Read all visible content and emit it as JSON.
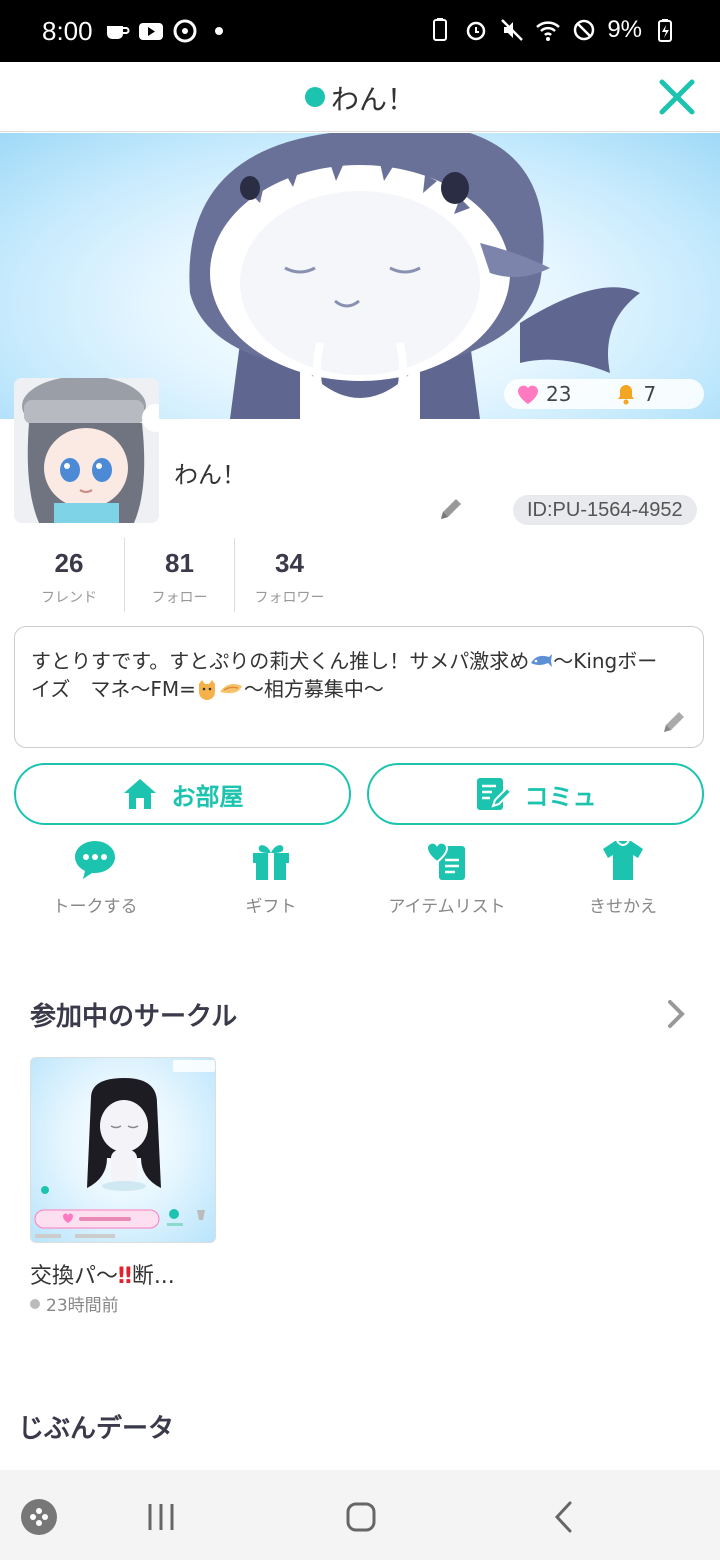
{
  "status_bar": {
    "time": "8:00",
    "battery": "9%"
  },
  "header": {
    "title": "わん！"
  },
  "banner": {
    "likes": "23",
    "bells": "7"
  },
  "profile": {
    "name": "わん！",
    "id": "ID:PU-1564-4952",
    "counts": [
      {
        "num": "26",
        "label": "フレンド"
      },
      {
        "num": "81",
        "label": "フォロー"
      },
      {
        "num": "34",
        "label": "フォロワー"
      }
    ],
    "bio_line1": "すとりすです。すとぷりの莉犬くん推し！サメパ激求め",
    "bio_line1_after": "〜Kingボー",
    "bio_line2_a": "イズ　マネ〜FM=",
    "bio_line2_b": "〜相方募集中〜"
  },
  "actions": {
    "room_label": "お部屋",
    "community_label": "コミュ",
    "talk_label": "トークする",
    "gift_label": "ギフト",
    "itemlist_label": "アイテムリスト",
    "dressup_label": "きせかえ"
  },
  "circles": {
    "section_title": "参加中のサークル",
    "card_title_a": "交換パ〜",
    "card_title_b": "‼",
    "card_title_c": "断...",
    "card_time": "23時間前"
  },
  "data_section": {
    "title": "じぶんデータ"
  },
  "colors": {
    "accent": "#1cc4b0",
    "pink": "#ff7ac0",
    "bell": "#f4a623"
  }
}
